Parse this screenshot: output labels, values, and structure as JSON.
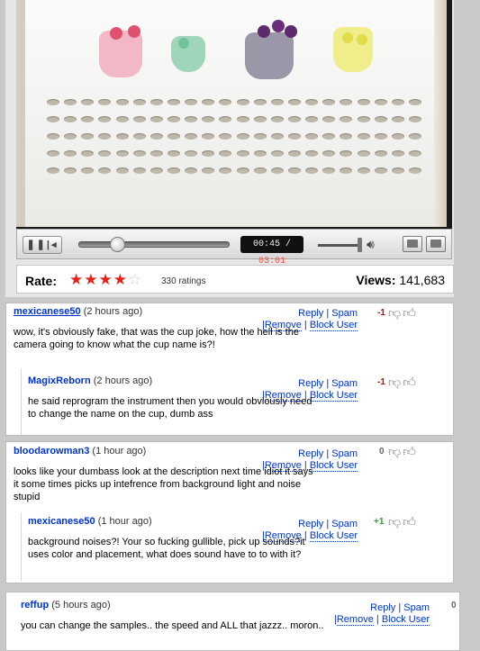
{
  "player": {
    "elapsed_time": "00:45",
    "total_time": "03:01",
    "progress": 0.25
  },
  "rating": {
    "label": "Rate:",
    "stars_filled": 4,
    "stars_total": 5,
    "count_text": "330 ratings",
    "views_label": "Views:",
    "views_value": "141,683"
  },
  "comments": [
    {
      "author": "mexicanese50",
      "time": "(2 hours ago)",
      "text": "wow, it's obviously fake, that was the cup joke, how the hell is the camera going to know what the cup name is?!",
      "score": "-1",
      "actions": {
        "reply": "Reply",
        "spam": "Spam",
        "remove": "Remove",
        "block": "Block User"
      }
    },
    {
      "author": "MagixReborn",
      "time": "(2 hours ago)",
      "text": "he said reprogram the instrument then you would obviously need to change the name on the cup, dumb ass",
      "score": "-1",
      "actions": {
        "reply": "Reply",
        "spam": "Spam",
        "remove": "Remove",
        "block": "Block User"
      }
    },
    {
      "author": "bloodarowman3",
      "time": "(1 hour ago)",
      "text": "looks like your dumbass look at the description next time idiot it says it some times picks up intefrence from background light and noise stupid",
      "score": "0",
      "actions": {
        "reply": "Reply",
        "spam": "Spam",
        "remove": "Remove",
        "block": "Block User"
      }
    },
    {
      "author": "mexicanese50",
      "time": "(1 hour ago)",
      "text": "background noises?! Your so fucking gullible, pick up sounds?it uses color and placement, what does sound have to to with it?",
      "score": "+1",
      "actions": {
        "reply": "Reply",
        "spam": "Spam",
        "remove": "Remove",
        "block": "Block User"
      }
    },
    {
      "author": "reffup",
      "time": "(5 hours ago)",
      "text": "you can change the samples.. the speed and ALL that jazzz.. moron..",
      "score": "0",
      "actions": {
        "reply": "Reply",
        "spam": "Spam",
        "remove": "Remove",
        "block": "Block User"
      }
    }
  ]
}
